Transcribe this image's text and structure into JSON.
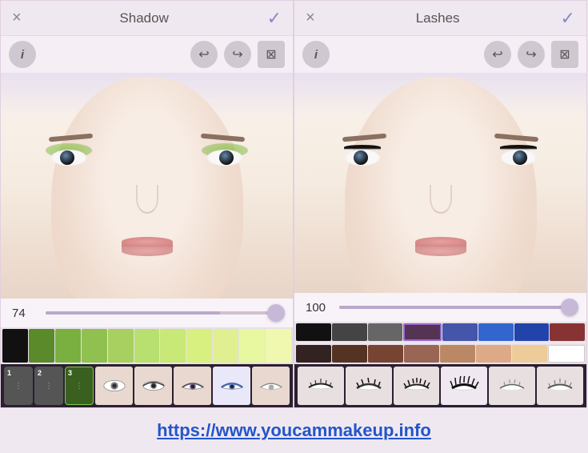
{
  "left_panel": {
    "title": "Shadow",
    "close_label": "×",
    "confirm_label": "✓",
    "toolbar": {
      "info_label": "i",
      "undo_label": "↩",
      "redo_label": "↪",
      "crop_label": "⊠"
    },
    "slider": {
      "value": "74",
      "fill_pct": 74
    },
    "swatches": [
      "#111111",
      "#5a8a2a",
      "#7ab040",
      "#90c050",
      "#a8d060",
      "#b8e070",
      "#c8e878",
      "#d8f080",
      "#e0f090",
      "#e8f8a0",
      "#f0f8b0"
    ],
    "tools": [
      {
        "label": "1",
        "active": false
      },
      {
        "label": "2",
        "active": false
      },
      {
        "label": "3",
        "active": true
      },
      {
        "label": "eye1",
        "active": false
      },
      {
        "label": "eye2",
        "active": false
      },
      {
        "label": "eye3",
        "active": false
      },
      {
        "label": "eye4",
        "active": false
      },
      {
        "label": "eye5",
        "active": false
      }
    ]
  },
  "right_panel": {
    "title": "Lashes",
    "close_label": "×",
    "confirm_label": "✓",
    "toolbar": {
      "info_label": "i",
      "undo_label": "↩",
      "redo_label": "↪",
      "crop_label": "⊠"
    },
    "slider": {
      "value": "100",
      "fill_pct": 100
    },
    "swatches_row1": [
      "#111111",
      "#444444",
      "#666666",
      "#553355",
      "#4455aa",
      "#3366cc",
      "#2244aa",
      "#883333"
    ],
    "swatches_row2": [
      "#332222",
      "#553322",
      "#774433",
      "#996655",
      "#bb8866",
      "#ddaa88",
      "#eecc99",
      "#ffffff"
    ],
    "tools": [
      {
        "label": "lash1",
        "active": false
      },
      {
        "label": "lash2",
        "active": false
      },
      {
        "label": "lash3",
        "active": false
      },
      {
        "label": "lash4",
        "active": false
      },
      {
        "label": "lash5",
        "active": false
      },
      {
        "label": "lash6",
        "active": false
      }
    ]
  },
  "footer": {
    "link_text": "https://www.youcammakeup.info",
    "link_url": "https://www.youcammakeup.info"
  }
}
